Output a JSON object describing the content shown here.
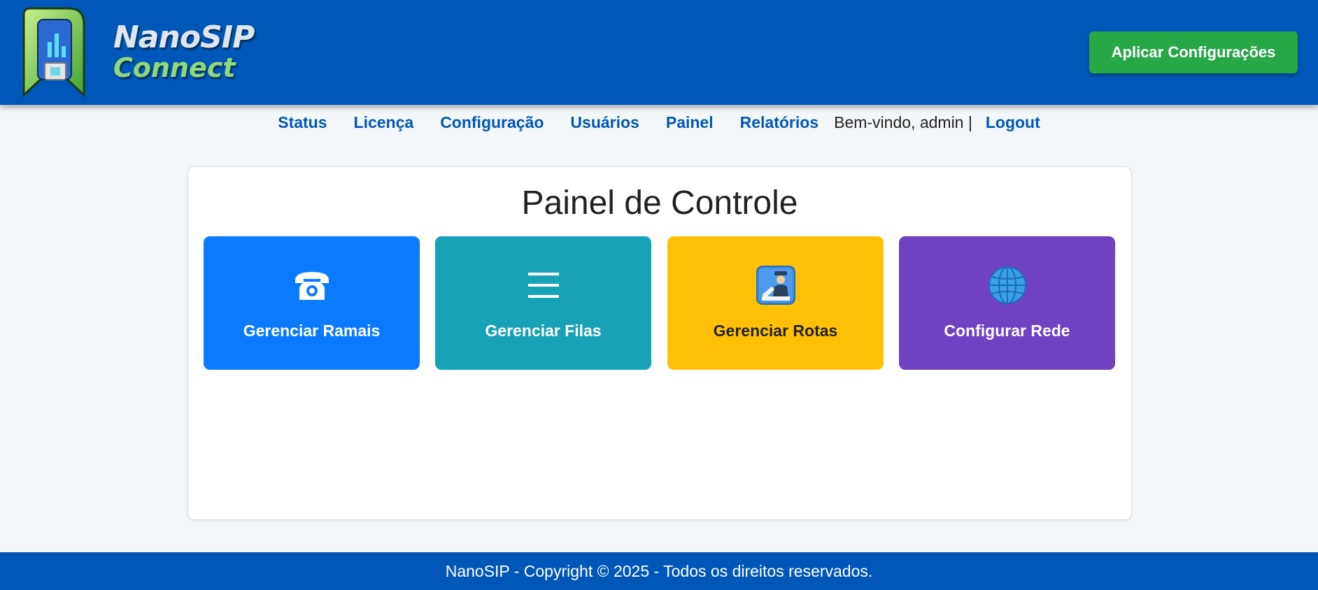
{
  "header": {
    "logo": {
      "line1": "NanoSIP",
      "line2": "Connect"
    },
    "apply_label": "Aplicar Configurações"
  },
  "nav": {
    "items": [
      {
        "label": "Status"
      },
      {
        "label": "Licença"
      },
      {
        "label": "Configuração"
      },
      {
        "label": "Usuários"
      },
      {
        "label": "Painel"
      },
      {
        "label": "Relatórios"
      }
    ],
    "welcome": "Bem-vindo, admin |",
    "logout": "Logout"
  },
  "dashboard": {
    "title": "Painel de Controle",
    "tiles": [
      {
        "label": "Gerenciar Ramais",
        "icon": "telephone-icon",
        "color": "#0a7bff"
      },
      {
        "label": "Gerenciar Filas",
        "icon": "list-icon",
        "color": "#17a2b8"
      },
      {
        "label": "Gerenciar Rotas",
        "icon": "passport-control-icon",
        "color": "#ffc107"
      },
      {
        "label": "Configurar Rede",
        "icon": "globe-icon",
        "color": "#6f42c1"
      }
    ]
  },
  "footer": {
    "text": "NanoSIP - Copyright © 2025 - Todos os direitos reservados."
  },
  "colors": {
    "brand": "#0057b7",
    "apply": "#28a745"
  }
}
